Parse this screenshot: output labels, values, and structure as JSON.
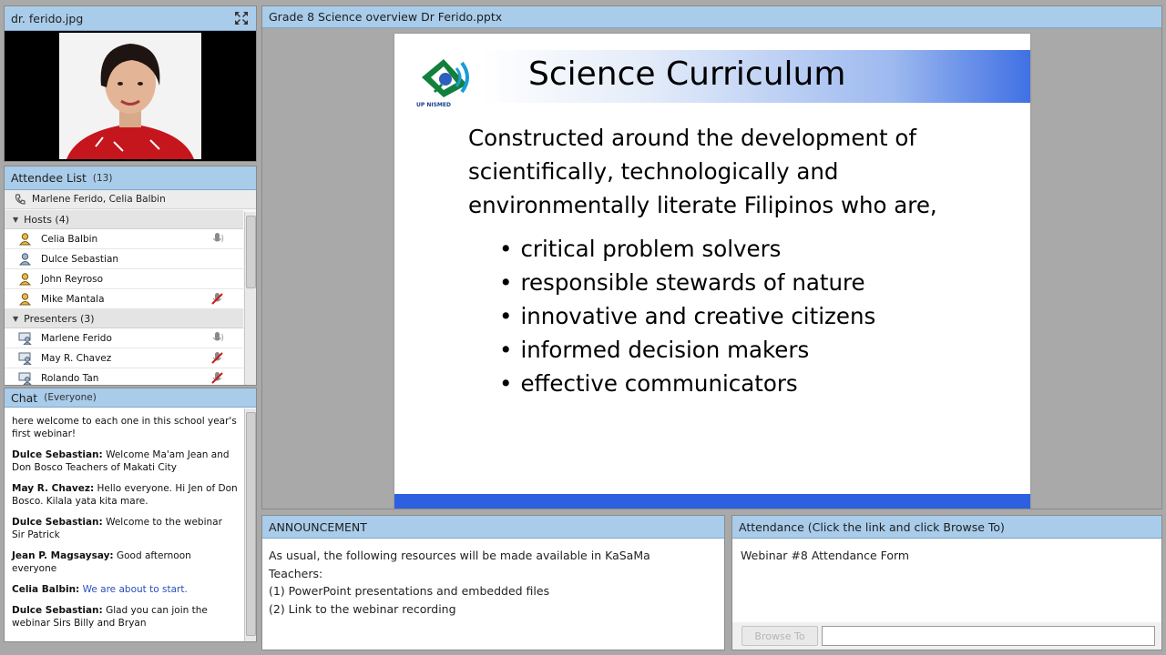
{
  "camera_pod": {
    "title": "dr. ferido.jpg",
    "expand_icon": "fullscreen-expand-icon"
  },
  "attendee_pod": {
    "title": "Attendee List",
    "count": "(13)",
    "speaking": "Marlene Ferido, Celia  Balbin",
    "groups": [
      {
        "label": "Hosts (4)",
        "people": [
          {
            "name": "Celia  Balbin",
            "icon": "host-icon",
            "status": "microphone-icon"
          },
          {
            "name": "Dulce Sebastian",
            "icon": "host-icon",
            "status": ""
          },
          {
            "name": "John  Reyroso",
            "icon": "host-icon",
            "status": ""
          },
          {
            "name": "Mike Mantala",
            "icon": "host-icon",
            "status": "mic-muted-icon"
          }
        ]
      },
      {
        "label": "Presenters (3)",
        "people": [
          {
            "name": "Marlene Ferido",
            "icon": "presenter-icon",
            "status": "microphone-icon"
          },
          {
            "name": "May R. Chavez",
            "icon": "presenter-icon",
            "status": "mic-muted-icon"
          },
          {
            "name": "Rolando Tan",
            "icon": "presenter-icon",
            "status": "mic-muted-icon"
          }
        ]
      }
    ]
  },
  "chat_pod": {
    "title": "Chat",
    "scope": "(Everyone)",
    "messages": [
      {
        "who": "",
        "text": "here welcome to each one in this school year's first webinar!"
      },
      {
        "who": "Dulce Sebastian:",
        "text": "Welcome Ma'am Jean and Don Bosco Teachers of Makati City"
      },
      {
        "who": "May R. Chavez:",
        "text": "Hello everyone. Hi Jen of Don Bosco. Kilala yata kita mare."
      },
      {
        "who": "Dulce Sebastian:",
        "text": "Welcome to the webinar Sir Patrick"
      },
      {
        "who": "Jean P. Magsaysay:",
        "text": "Good afternoon everyone"
      },
      {
        "who": "Celia  Balbin:",
        "text": "We are about to start."
      },
      {
        "who": "Dulce Sebastian:",
        "text": "Glad you can join the webinar Sirs Billy and Bryan"
      }
    ]
  },
  "share_pod": {
    "title": "Grade 8 Science overview Dr Ferido.pptx",
    "slide": {
      "title": "Science Curriculum",
      "logo_text": "UP NISMED",
      "intro_lines": [
        "Constructed around the development of",
        "scientifically, technologically and",
        "environmentally literate Filipinos who are,"
      ],
      "bullets": [
        "critical problem solvers",
        "responsible stewards of nature",
        "innovative and creative citizens",
        "informed decision makers",
        "effective communicators"
      ]
    }
  },
  "announcement_pod": {
    "title": "ANNOUNCEMENT",
    "lines": [
      "As usual, the following resources will be made available in KaSaMa",
      "Teachers:",
      "(1) PowerPoint presentations and embedded files",
      "(2) Link to the webinar recording"
    ]
  },
  "attendance_pod": {
    "title": "Attendance (Click the link and click Browse To)",
    "link_text": "Webinar #8 Attendance Form",
    "browse_label": "Browse To",
    "url_value": ""
  },
  "colors": {
    "pod_header": "#a9ccea",
    "slide_accent": "#2d60e0",
    "chat_highlight": "#2a4fb8"
  }
}
